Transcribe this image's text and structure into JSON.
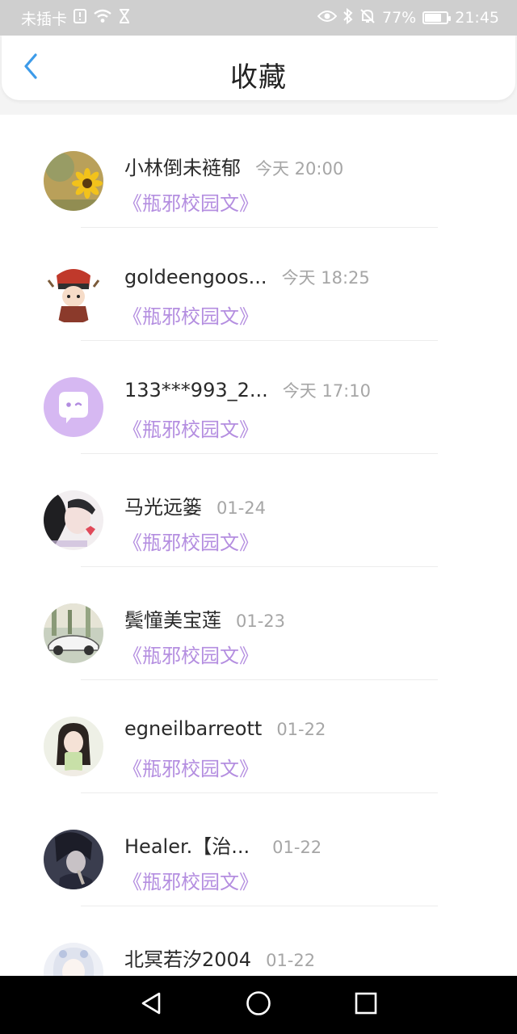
{
  "status_bar": {
    "carrier": "未插卡",
    "battery": "77%",
    "battery_level": 0.77,
    "time": "21:45",
    "icons": [
      "sim-alert-icon",
      "wifi-icon",
      "hourglass-icon",
      "eye-icon",
      "bluetooth-icon",
      "bell-off-icon",
      "battery-icon"
    ]
  },
  "header": {
    "title": "收藏",
    "back_icon": "chevron-left-icon"
  },
  "items": [
    {
      "name": "小林倒未裢郁",
      "time": "今天 20:00",
      "book": "《瓶邪校园文》",
      "avatar": "sunflower"
    },
    {
      "name": "goldeengoos...",
      "time": "今天 18:25",
      "book": "《瓶邪校园文》",
      "avatar": "anime-character"
    },
    {
      "name": "133***993_2...",
      "time": "今天 17:10",
      "book": "《瓶邪校园文》",
      "avatar": "default-chat"
    },
    {
      "name": "马光远篓",
      "time": "01-24",
      "book": "《瓶邪校园文》",
      "avatar": "portrait"
    },
    {
      "name": "鬓憧美宝莲",
      "time": "01-23",
      "book": "《瓶邪校园文》",
      "avatar": "car"
    },
    {
      "name": "egneilbarreott",
      "time": "01-22",
      "book": "《瓶邪校园文》",
      "avatar": "girl"
    },
    {
      "name": "Healer.【治...",
      "time": "01-22",
      "book": "《瓶邪校园文》",
      "avatar": "dark-anime"
    },
    {
      "name": "北冥若汐2004",
      "time": "01-22",
      "book": "",
      "avatar": "white-hair"
    }
  ],
  "nav": {
    "back": "triangle-back-icon",
    "home": "circle-home-icon",
    "recents": "square-recents-icon"
  },
  "colors": {
    "accent": "#3d9be9",
    "book_link": "#b48ee0",
    "status_bar": "#cfcfcf"
  }
}
